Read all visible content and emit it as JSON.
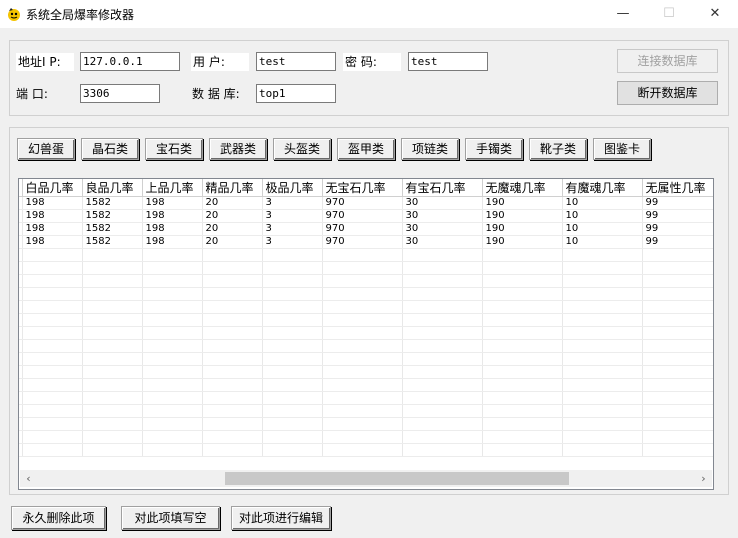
{
  "window": {
    "title": "系统全局爆率修改器",
    "minimize": "—",
    "maximize": "☐",
    "close": "✕"
  },
  "connection": {
    "ip_label": "地址I P:",
    "ip_value": "127.0.0.1",
    "user_label": "用    户:",
    "user_value": "test",
    "password_label": "密    码:",
    "password_value": "test",
    "port_label": "端    口:",
    "port_value": "3306",
    "db_label": "数 据 库:",
    "db_value": "top1",
    "connect_button": "连接数据库",
    "disconnect_button": "断开数据库"
  },
  "categories": [
    "幻兽蛋",
    "晶石类",
    "宝石类",
    "武器类",
    "头盔类",
    "盔甲类",
    "项链类",
    "手镯类",
    "靴子类",
    "图鉴卡"
  ],
  "table": {
    "columns": [
      "白品几率",
      "良品几率",
      "上品几率",
      "精品几率",
      "极品几率",
      "无宝石几率",
      "有宝石几率",
      "无魔魂几率",
      "有魔魂几率",
      "无属性几率"
    ],
    "rows": [
      [
        "198",
        "1582",
        "198",
        "20",
        "3",
        "970",
        "30",
        "190",
        "10",
        "99"
      ],
      [
        "198",
        "1582",
        "198",
        "20",
        "3",
        "970",
        "30",
        "190",
        "10",
        "99"
      ],
      [
        "198",
        "1582",
        "198",
        "20",
        "3",
        "970",
        "30",
        "190",
        "10",
        "99"
      ],
      [
        "198",
        "1582",
        "198",
        "20",
        "3",
        "970",
        "30",
        "190",
        "10",
        "99"
      ]
    ]
  },
  "actions": {
    "delete_button": "永久删除此项",
    "clear_button": "对此项填写空",
    "edit_button": "对此项进行编辑"
  }
}
